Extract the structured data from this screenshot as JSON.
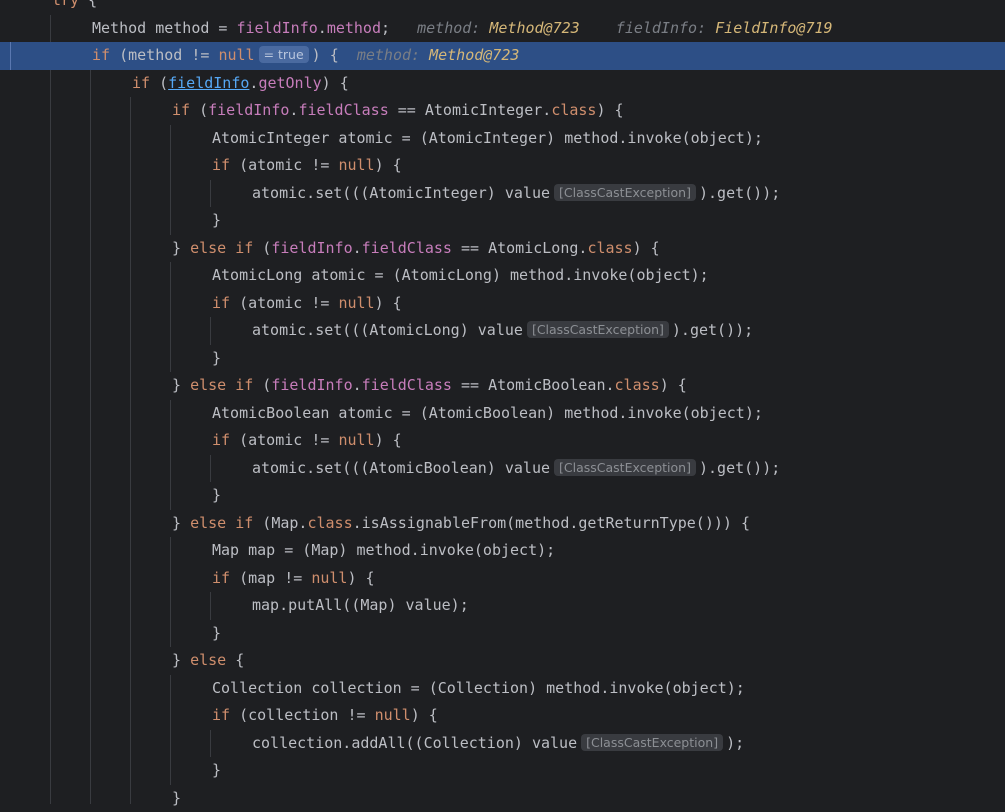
{
  "editor": {
    "lines": [
      {
        "indent": 1,
        "tokens": [
          {
            "t": "try",
            "c": "kw"
          },
          {
            "t": " {"
          }
        ]
      },
      {
        "indent": 2,
        "tokens": [
          {
            "t": "Method method = "
          },
          {
            "t": "fieldInfo",
            "c": "fld"
          },
          {
            "t": "."
          },
          {
            "t": "method",
            "c": "fld"
          },
          {
            "t": ";"
          },
          {
            "t": "   method: ",
            "c": "hint-name"
          },
          {
            "t": "Method@723",
            "c": "hint-val"
          },
          {
            "t": "    fieldInfo: ",
            "c": "hint-name"
          },
          {
            "t": "FieldInfo@719",
            "c": "hint-val"
          }
        ]
      },
      {
        "indent": 2,
        "exec": true,
        "tokens": [
          {
            "t": "if",
            "c": "kw"
          },
          {
            "t": " (method != "
          },
          {
            "t": "null",
            "c": "kw"
          },
          {
            "t": "= true",
            "c": "inlay"
          },
          {
            "t": ") {"
          },
          {
            "t": "  method: ",
            "c": "hint-name"
          },
          {
            "t": "Method@723",
            "c": "hint-val"
          }
        ]
      },
      {
        "indent": 3,
        "tokens": [
          {
            "t": "if",
            "c": "kw"
          },
          {
            "t": " ("
          },
          {
            "t": "fieldInfo",
            "c": "link"
          },
          {
            "t": "."
          },
          {
            "t": "getOnly",
            "c": "fld"
          },
          {
            "t": ") {"
          }
        ]
      },
      {
        "indent": 4,
        "tokens": [
          {
            "t": "if",
            "c": "kw"
          },
          {
            "t": " ("
          },
          {
            "t": "fieldInfo",
            "c": "fld"
          },
          {
            "t": "."
          },
          {
            "t": "fieldClass",
            "c": "fld"
          },
          {
            "t": " == AtomicInteger."
          },
          {
            "t": "class",
            "c": "kw"
          },
          {
            "t": ") {"
          }
        ]
      },
      {
        "indent": 5,
        "tokens": [
          {
            "t": "AtomicInteger atomic = (AtomicInteger) method.invoke(object);"
          }
        ]
      },
      {
        "indent": 5,
        "tokens": [
          {
            "t": "if",
            "c": "kw"
          },
          {
            "t": " (atomic != "
          },
          {
            "t": "null",
            "c": "kw"
          },
          {
            "t": ") {"
          }
        ]
      },
      {
        "indent": 6,
        "tokens": [
          {
            "t": "atomic.set(((AtomicInteger) value"
          },
          {
            "t": "[ClassCastException]",
            "c": "inlay"
          },
          {
            "t": ").get());"
          }
        ]
      },
      {
        "indent": 5,
        "tokens": [
          {
            "t": "}"
          }
        ]
      },
      {
        "indent": 4,
        "tokens": [
          {
            "t": "} "
          },
          {
            "t": "else if",
            "c": "kw"
          },
          {
            "t": " ("
          },
          {
            "t": "fieldInfo",
            "c": "fld"
          },
          {
            "t": "."
          },
          {
            "t": "fieldClass",
            "c": "fld"
          },
          {
            "t": " == AtomicLong."
          },
          {
            "t": "class",
            "c": "kw"
          },
          {
            "t": ") {"
          }
        ]
      },
      {
        "indent": 5,
        "tokens": [
          {
            "t": "AtomicLong atomic = (AtomicLong) method.invoke(object);"
          }
        ]
      },
      {
        "indent": 5,
        "tokens": [
          {
            "t": "if",
            "c": "kw"
          },
          {
            "t": " (atomic != "
          },
          {
            "t": "null",
            "c": "kw"
          },
          {
            "t": ") {"
          }
        ]
      },
      {
        "indent": 6,
        "tokens": [
          {
            "t": "atomic.set(((AtomicLong) value"
          },
          {
            "t": "[ClassCastException]",
            "c": "inlay"
          },
          {
            "t": ").get());"
          }
        ]
      },
      {
        "indent": 5,
        "tokens": [
          {
            "t": "}"
          }
        ]
      },
      {
        "indent": 4,
        "tokens": [
          {
            "t": "} "
          },
          {
            "t": "else if",
            "c": "kw"
          },
          {
            "t": " ("
          },
          {
            "t": "fieldInfo",
            "c": "fld"
          },
          {
            "t": "."
          },
          {
            "t": "fieldClass",
            "c": "fld"
          },
          {
            "t": " == AtomicBoolean."
          },
          {
            "t": "class",
            "c": "kw"
          },
          {
            "t": ") {"
          }
        ]
      },
      {
        "indent": 5,
        "tokens": [
          {
            "t": "AtomicBoolean atomic = (AtomicBoolean) method.invoke(object);"
          }
        ]
      },
      {
        "indent": 5,
        "tokens": [
          {
            "t": "if",
            "c": "kw"
          },
          {
            "t": " (atomic != "
          },
          {
            "t": "null",
            "c": "kw"
          },
          {
            "t": ") {"
          }
        ]
      },
      {
        "indent": 6,
        "tokens": [
          {
            "t": "atomic.set(((AtomicBoolean) value"
          },
          {
            "t": "[ClassCastException]",
            "c": "inlay"
          },
          {
            "t": ").get());"
          }
        ]
      },
      {
        "indent": 5,
        "tokens": [
          {
            "t": "}"
          }
        ]
      },
      {
        "indent": 4,
        "tokens": [
          {
            "t": "} "
          },
          {
            "t": "else if",
            "c": "kw"
          },
          {
            "t": " (Map."
          },
          {
            "t": "class",
            "c": "kw"
          },
          {
            "t": ".isAssignableFrom(method.getReturnType())) {"
          }
        ]
      },
      {
        "indent": 5,
        "tokens": [
          {
            "t": "Map map = (Map) method.invoke(object);"
          }
        ]
      },
      {
        "indent": 5,
        "tokens": [
          {
            "t": "if",
            "c": "kw"
          },
          {
            "t": " (map != "
          },
          {
            "t": "null",
            "c": "kw"
          },
          {
            "t": ") {"
          }
        ]
      },
      {
        "indent": 6,
        "tokens": [
          {
            "t": "map.putAll((Map) value);"
          }
        ]
      },
      {
        "indent": 5,
        "tokens": [
          {
            "t": "}"
          }
        ]
      },
      {
        "indent": 4,
        "tokens": [
          {
            "t": "} "
          },
          {
            "t": "else",
            "c": "kw"
          },
          {
            "t": " {"
          }
        ]
      },
      {
        "indent": 5,
        "tokens": [
          {
            "t": "Collection collection = (Collection) method.invoke(object);"
          }
        ]
      },
      {
        "indent": 5,
        "tokens": [
          {
            "t": "if",
            "c": "kw"
          },
          {
            "t": " (collection != "
          },
          {
            "t": "null",
            "c": "kw"
          },
          {
            "t": ") {"
          }
        ]
      },
      {
        "indent": 6,
        "tokens": [
          {
            "t": "collection.addAll((Collection) value"
          },
          {
            "t": "[ClassCastException]",
            "c": "inlay"
          },
          {
            "t": ");"
          }
        ]
      },
      {
        "indent": 5,
        "tokens": [
          {
            "t": "}"
          }
        ]
      },
      {
        "indent": 4,
        "tokens": [
          {
            "t": "}"
          }
        ]
      }
    ]
  }
}
